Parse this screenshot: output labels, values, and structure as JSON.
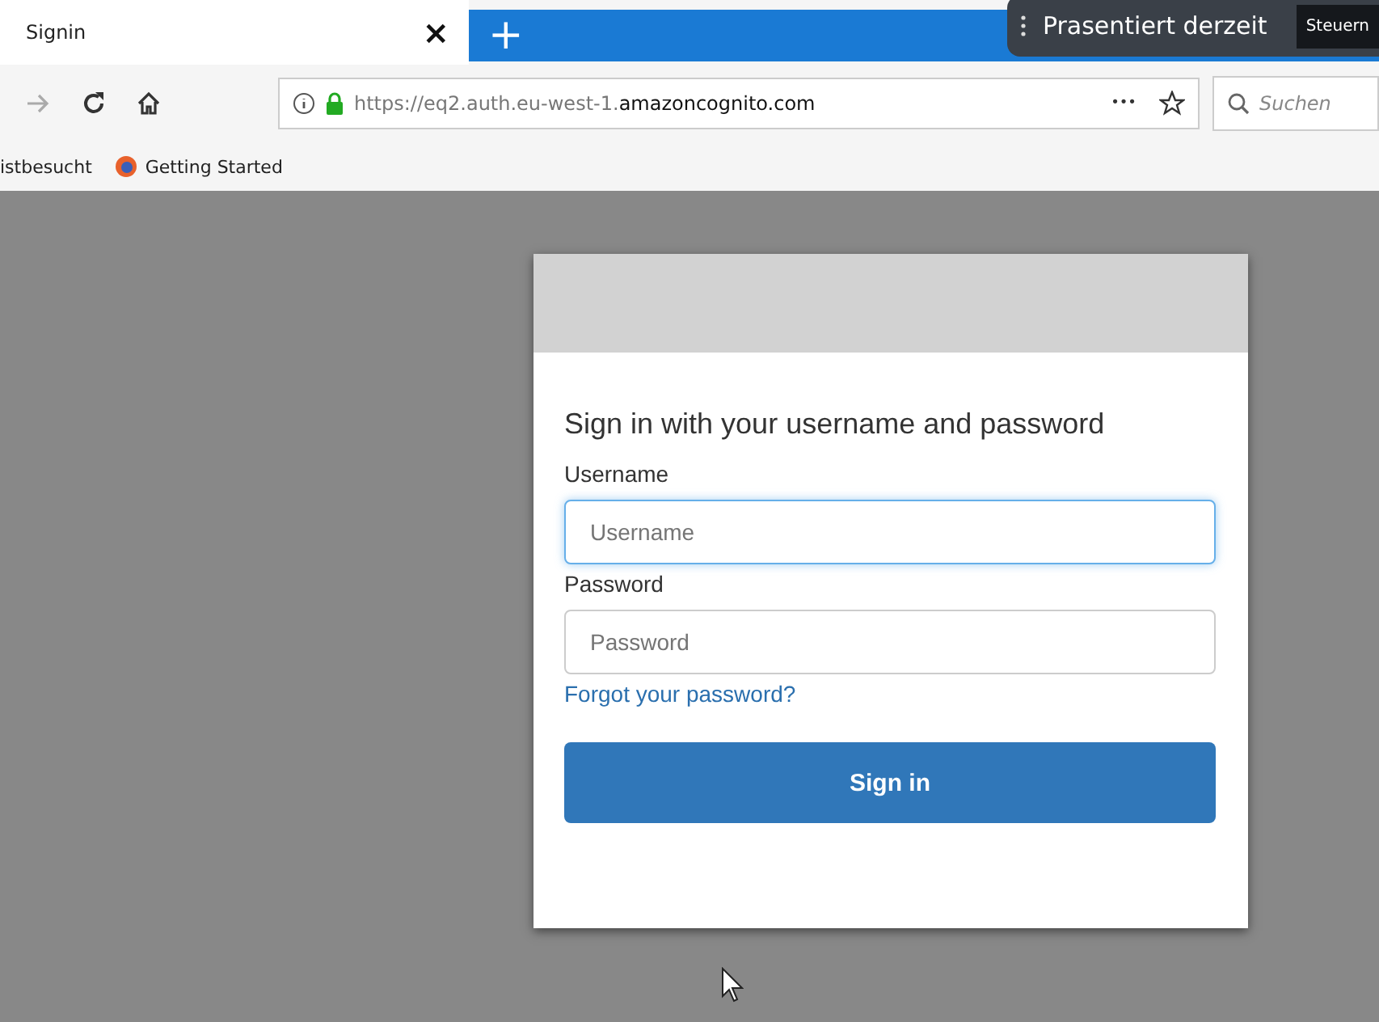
{
  "tab": {
    "title": "Signin",
    "close": "×",
    "new_tab": "+"
  },
  "presenting": {
    "label": "Prasentiert derzeit",
    "button": "Steuern"
  },
  "toolbar": {
    "url_prefix": "https://eq2.auth.eu-west-1.",
    "url_domain": "amazoncognito.com",
    "more": "•••",
    "search_placeholder": "Suchen"
  },
  "bookmarks": [
    {
      "label": "istbesucht",
      "kind": "plain"
    },
    {
      "label": "Getting Started",
      "kind": "firefox"
    }
  ],
  "form": {
    "heading": "Sign in with your username and password",
    "fields": [
      {
        "label": "Username",
        "placeholder": "Username",
        "focused": true
      },
      {
        "label": "Password",
        "placeholder": "Password",
        "focused": false
      }
    ],
    "forgot_link": "Forgot your password?",
    "submit": "Sign in"
  }
}
